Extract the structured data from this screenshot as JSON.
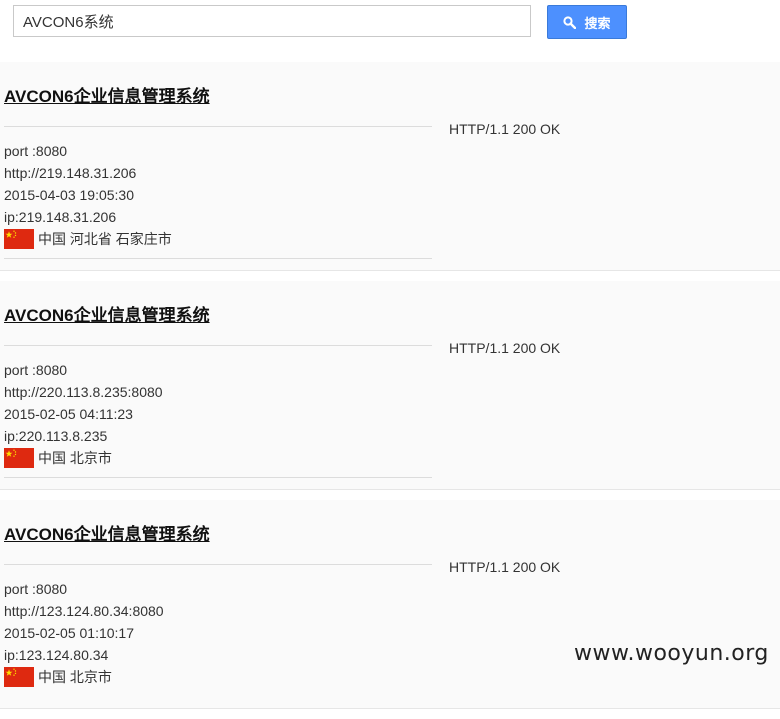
{
  "search": {
    "query": "AVCON6系统",
    "button_label": "搜索"
  },
  "results": [
    {
      "title": "AVCON6企业信息管理系统",
      "status": "HTTP/1.1 200 OK",
      "port": "port :8080",
      "url": "http://219.148.31.206",
      "time": "2015-04-03 19:05:30",
      "ip": "ip:219.148.31.206",
      "location": "中国 河北省 石家庄市"
    },
    {
      "title": "AVCON6企业信息管理系统",
      "status": "HTTP/1.1 200 OK",
      "port": "port :8080",
      "url": "http://220.113.8.235:8080",
      "time": "2015-02-05 04:11:23",
      "ip": "ip:220.113.8.235",
      "location": "中国 北京市"
    },
    {
      "title": "AVCON6企业信息管理系统",
      "status": "HTTP/1.1 200 OK",
      "port": "port :8080",
      "url": "http://123.124.80.34:8080",
      "time": "2015-02-05 01:10:17",
      "ip": "ip:123.124.80.34",
      "location": "中国 北京市"
    }
  ],
  "watermark": "www.wooyun.org",
  "colors": {
    "button": "#4d90fe",
    "flag_red": "#de2910",
    "flag_star": "#ffde00"
  }
}
